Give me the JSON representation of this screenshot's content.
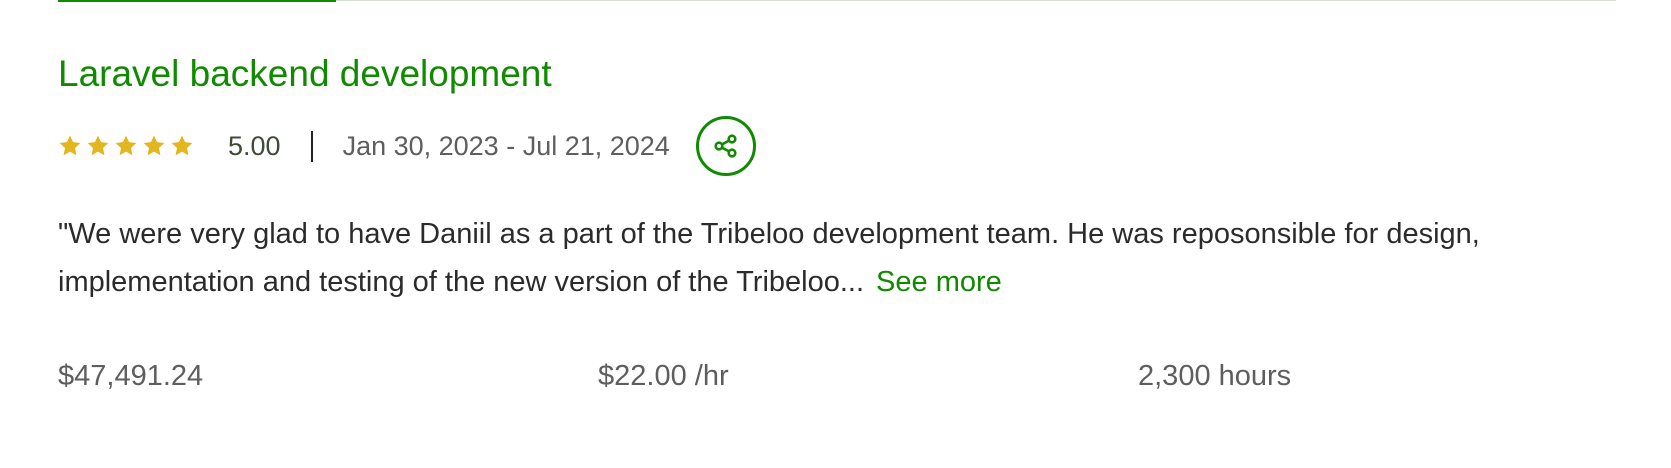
{
  "job": {
    "title": "Laravel backend development",
    "rating": "5.00",
    "star_count": 5,
    "dates": "Jan 30, 2023 - Jul 21, 2024",
    "review_text": "\"We were very glad to have Daniil as a part of the Tribeloo development team. He was reposonsible for design, implementation and testing of the new version of the Tribeloo...",
    "see_more_label": "See more",
    "earnings": "$47,491.24",
    "hourly_rate": "$22.00 /hr",
    "hours": "2,300 hours"
  },
  "icons": {
    "star": "star-icon",
    "share": "share-icon"
  },
  "colors": {
    "accent": "#108a00",
    "star": "#e3b51e",
    "text": "#2b2b2b",
    "muted": "#5e5e5e"
  }
}
